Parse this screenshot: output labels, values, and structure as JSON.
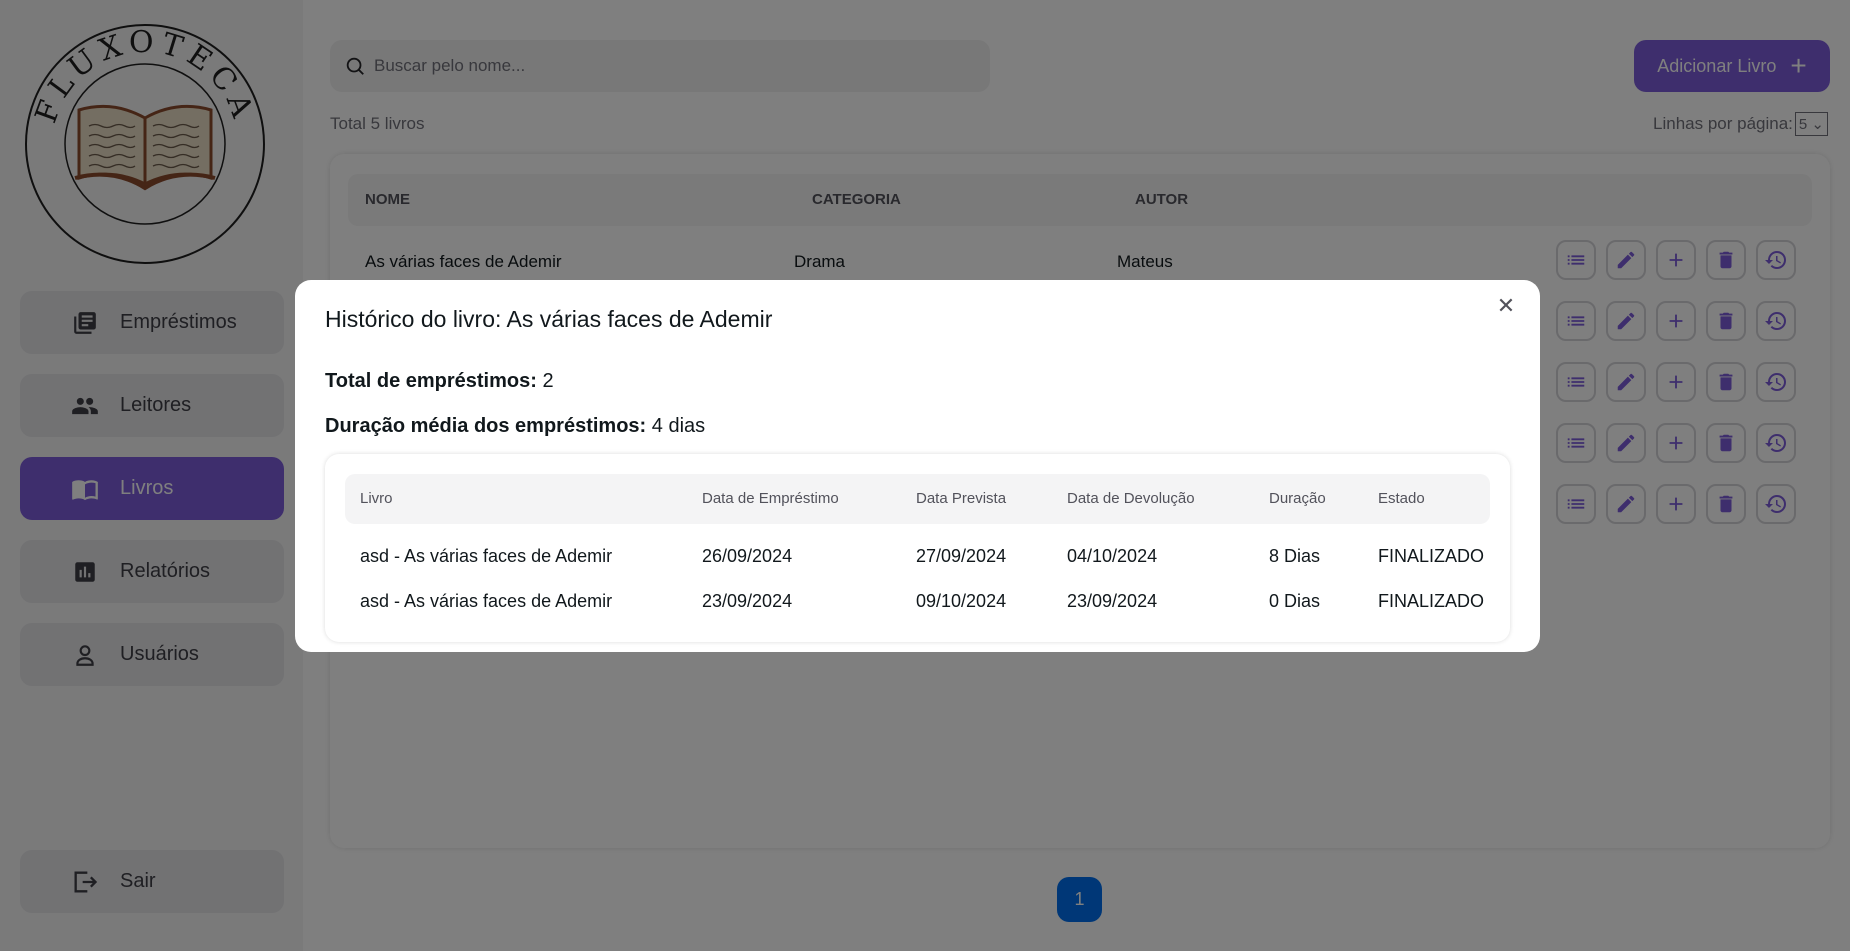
{
  "logo": {
    "text": "FLUXOTECA"
  },
  "sidebar": {
    "items": [
      {
        "label": "Empréstimos",
        "icon": "library-books-icon"
      },
      {
        "label": "Leitores",
        "icon": "people-icon"
      },
      {
        "label": "Livros",
        "icon": "open-book-icon",
        "active": true
      },
      {
        "label": "Relatórios",
        "icon": "bar-chart-icon"
      },
      {
        "label": "Usuários",
        "icon": "person-icon"
      }
    ],
    "logout_label": "Sair"
  },
  "header": {
    "search_placeholder": "Buscar pelo nome...",
    "add_button_label": "Adicionar Livro",
    "total_label": "Total 5 livros",
    "rows_per_page_label": "Linhas por página:",
    "rows_per_page_value": "5"
  },
  "books_table": {
    "columns": [
      "NOME",
      "CATEGORIA",
      "AUTOR"
    ],
    "rows": [
      {
        "nome": "As várias faces de Ademir",
        "categoria": "Drama",
        "autor": "Mateus"
      }
    ],
    "row_count": 5
  },
  "pagination": {
    "current_page": "1"
  },
  "modal": {
    "title": "Histórico do livro: As várias faces de Ademir",
    "total_label": "Total de empréstimos:",
    "total_value": "2",
    "avg_label": "Duração média dos empréstimos:",
    "avg_value": "4 dias",
    "columns": [
      "Livro",
      "Data de Empréstimo",
      "Data Prevista",
      "Data de Devolução",
      "Duração",
      "Estado"
    ],
    "rows": [
      [
        "asd - As várias faces de Ademir",
        "26/09/2024",
        "27/09/2024",
        "04/10/2024",
        "8 Dias",
        "FINALIZADO"
      ],
      [
        "asd - As várias faces de Ademir",
        "23/09/2024",
        "09/10/2024",
        "23/09/2024",
        "0 Dias",
        "FINALIZADO"
      ]
    ]
  },
  "colors": {
    "accent": "#7c5cdb",
    "pager": "#006fee",
    "overlay": "rgba(0,0,0,0.5)"
  }
}
